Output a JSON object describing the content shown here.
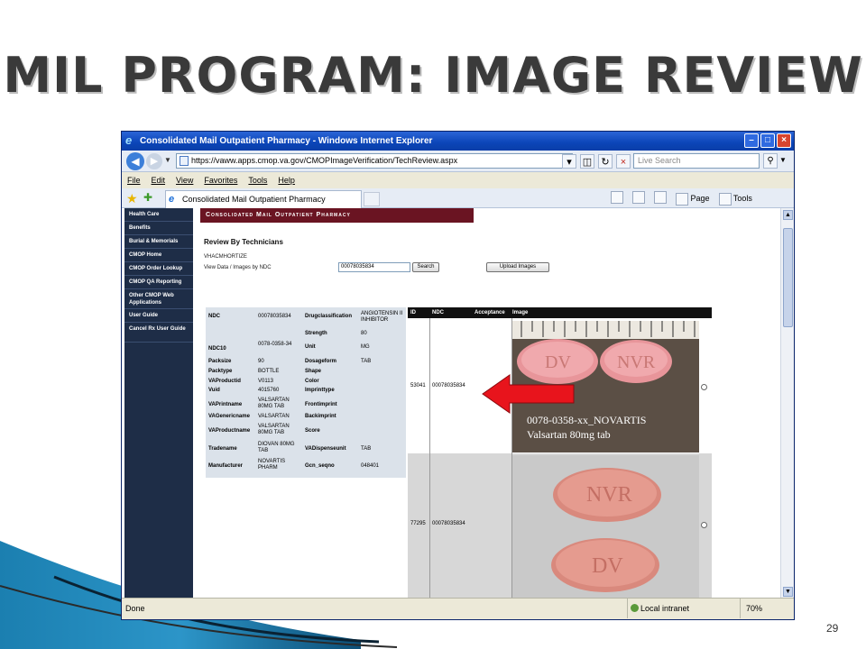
{
  "slide": {
    "title": "MIL PROGRAM: IMAGE REVIEW",
    "page_number": "29"
  },
  "browser": {
    "window_title": "Consolidated Mail Outpatient Pharmacy - Windows Internet Explorer",
    "url": "https://vaww.apps.cmop.va.gov/CMOPImageVerification/TechReview.aspx",
    "search_placeholder": "Live Search",
    "menu": [
      "File",
      "Edit",
      "View",
      "Favorites",
      "Tools",
      "Help"
    ],
    "tab_label": "Consolidated Mail Outpatient Pharmacy",
    "commands": {
      "page": "Page",
      "tools": "Tools"
    },
    "status": {
      "text": "Done",
      "zone": "Local intranet",
      "zoom": "70%"
    }
  },
  "sidenav": {
    "items": [
      "Health Care",
      "Benefits",
      "Burial & Memorials",
      "CMOP Home",
      "CMOP Order Lookup",
      "CMOP QA Reporting",
      "Other CMOP Web Applications",
      "User Guide",
      "Cancel Rx User Guide"
    ]
  },
  "page": {
    "banner": "Consolidated Mail Outpatient Pharmacy",
    "heading": "Review By Technicians",
    "user": "VHACMHORTIZE",
    "view_label": "View Data / Images by NDC",
    "ndc_value": "00078035834",
    "search_button": "Search",
    "upload_button": "Upload Images"
  },
  "details": [
    {
      "k1": "NDC",
      "v1": "00078035834",
      "k2": "Drugclassification",
      "v2": "ANGIOTENSIN II INHIBITOR"
    },
    {
      "k1": "",
      "v1": "",
      "k2": "Strength",
      "v2": "80"
    },
    {
      "k1": "NDC10",
      "v1": "0078-0358-34",
      "k2": "Unit",
      "v2": "MG"
    },
    {
      "k1": "Packsize",
      "v1": "90",
      "k2": "Dosageform",
      "v2": "TAB"
    },
    {
      "k1": "Packtype",
      "v1": "BOTTLE",
      "k2": "Shape",
      "v2": ""
    },
    {
      "k1": "VAProductid",
      "v1": "V0113",
      "k2": "Color",
      "v2": ""
    },
    {
      "k1": "Vuid",
      "v1": "4015760",
      "k2": "Imprinttype",
      "v2": ""
    },
    {
      "k1": "VAPrintname",
      "v1": "VALSARTAN 80MG TAB",
      "k2": "Frontimprint",
      "v2": ""
    },
    {
      "k1": "VAGenericname",
      "v1": "VALSARTAN",
      "k2": "Backimprint",
      "v2": ""
    },
    {
      "k1": "VAProductname",
      "v1": "VALSARTAN 80MG TAB",
      "k2": "Score",
      "v2": ""
    },
    {
      "k1": "Tradename",
      "v1": "DIOVAN 80MG TAB",
      "k2": "VADispenseunit",
      "v2": "TAB"
    },
    {
      "k1": "Manufacturer",
      "v1": "NOVARTIS PHARM",
      "k2": "Gcn_seqno",
      "v2": "048401"
    }
  ],
  "results": {
    "headers": {
      "id": "ID",
      "ndc": "NDC",
      "acceptance": "Acceptance",
      "image": "Image"
    },
    "rows": [
      {
        "id": "53041",
        "ndc": "00078035834",
        "caption_line1": "0078-0358-xx_NOVARTIS",
        "caption_line2": "Valsartan 80mg tab",
        "pill_imprints": [
          "DV",
          "NVR"
        ]
      },
      {
        "id": "77295",
        "ndc": "00078035834",
        "pill_imprints": [
          "NVR",
          "DV"
        ]
      }
    ]
  },
  "colors": {
    "banner": "#6a1422",
    "sidenav": "#1e2d47",
    "arrow": "#e8141c",
    "title": "#3a3a3a"
  }
}
